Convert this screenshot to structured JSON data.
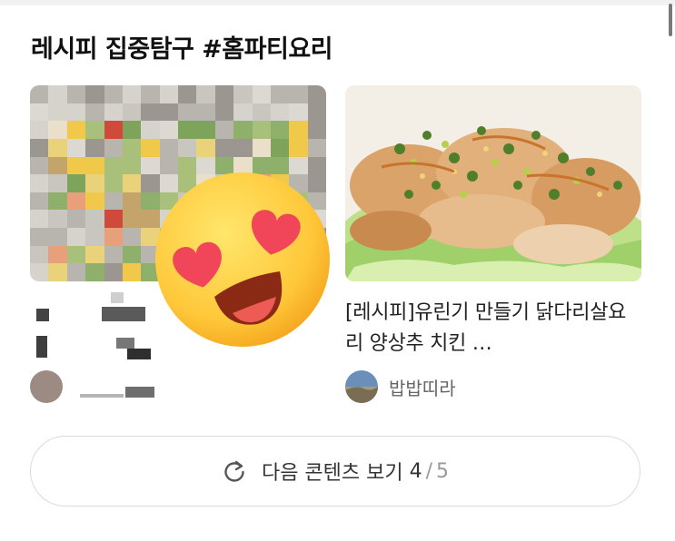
{
  "section": {
    "title": "레시피 집중탐구 #홈파티요리"
  },
  "cards": [
    {
      "title": "",
      "author": ""
    },
    {
      "title": "[레시피]유린기 만들기 닭다리살요리 양상추 치킨 …",
      "author": "밥밥띠라"
    }
  ],
  "icons": {
    "emoji": "heart-eyes-emoji-icon",
    "refresh": "refresh-icon"
  },
  "footer": {
    "next_label": "다음 콘텐츠 보기",
    "page_current": "4",
    "page_separator": "/",
    "page_total": "5"
  }
}
